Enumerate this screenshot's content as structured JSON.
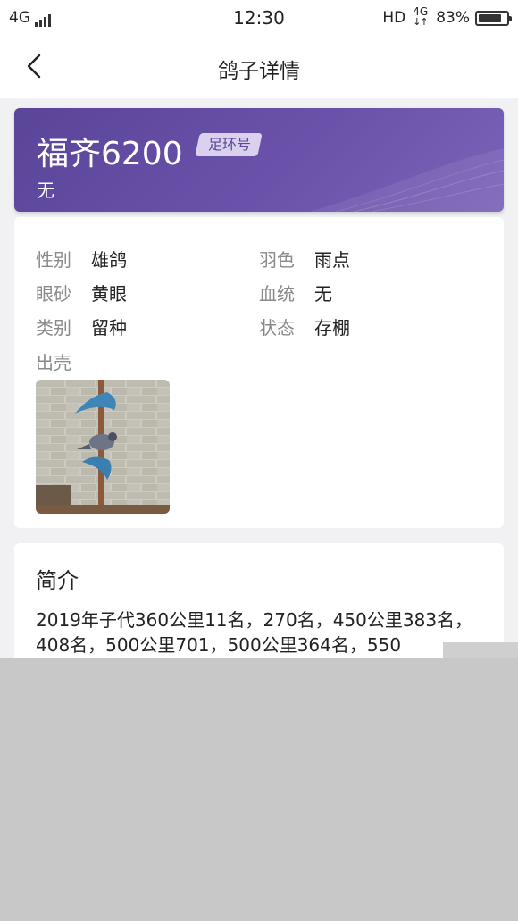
{
  "status_bar": {
    "network_left": "4G",
    "time": "12:30",
    "hd": "HD",
    "network_right": "4G",
    "battery": "83%",
    "battery_level": 0.83
  },
  "nav": {
    "title": "鸽子详情"
  },
  "header": {
    "name": "福齐6200",
    "tag": "足环号",
    "subtitle": "无",
    "gradient_colors": [
      "#5a4599",
      "#7b63b8"
    ]
  },
  "info": {
    "sex_label": "性别",
    "sex_value": "雄鸽",
    "feather_label": "羽色",
    "feather_value": "雨点",
    "eye_label": "眼砂",
    "eye_value": "黄眼",
    "lineage_label": "血统",
    "lineage_value": "无",
    "category_label": "类别",
    "category_value": "留种",
    "status_label": "状态",
    "status_value": "存棚",
    "hatch_label": "出壳"
  },
  "intro": {
    "title": "简介",
    "text": "2019年子代360公里11名，270名，450公里383名，408名，500公里701，500公里364名，550"
  }
}
